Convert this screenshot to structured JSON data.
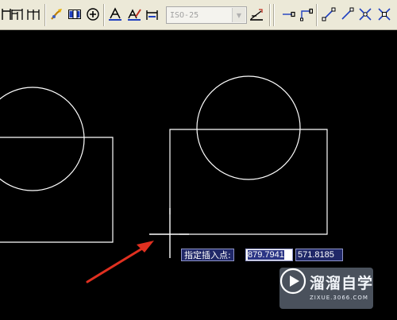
{
  "toolbar": {
    "dimension_style": "ISO-25",
    "icons": [
      "linear-dimension-icon",
      "baseline-dimension-icon",
      "continue-dimension-icon",
      "quick-leader-icon",
      "tolerance-icon",
      "center-mark-icon",
      "dimension-edit-icon",
      "dimension-text-edit-icon",
      "dimension-update-icon",
      "dimension-style-icon",
      "snap-endpoint-icon",
      "snap-midpoint-icon",
      "snap-intersection-icon",
      "snap-extension-icon",
      "snap-center-icon"
    ]
  },
  "dynamic_input": {
    "prompt": "指定插入点:",
    "x_value": "879.7941",
    "y_value": "571.8185"
  },
  "watermark": {
    "title": "溜溜自学",
    "url": "ZIXUE.3066.COM"
  },
  "colors": {
    "canvas_bg": "#000000",
    "geometry": "#ffffff",
    "annotation_arrow": "#e03020",
    "prompt_bg": "#202868",
    "toolbar_bg": "#ece9d8"
  }
}
